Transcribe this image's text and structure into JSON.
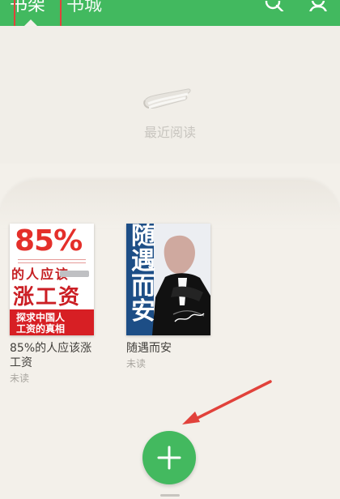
{
  "header": {
    "tabs": [
      {
        "label": "书架",
        "active": true
      },
      {
        "label": "书城",
        "active": false
      }
    ],
    "icons": [
      "search-icon",
      "user-icon"
    ]
  },
  "recent": {
    "icon": "bookmark-icon",
    "label": "最近阅读"
  },
  "books": [
    {
      "title_lines": [
        "85%的人应该涨",
        "工资"
      ],
      "status": "未读",
      "cover": {
        "headline": "85%",
        "subtitle": "的人应该",
        "main": "涨工资",
        "band_line_1": "探求中国人",
        "band_line_2": "工资的真相",
        "accent": "#d71f24"
      }
    },
    {
      "title_lines": [
        "随遇而安"
      ],
      "status": "未读",
      "cover": {
        "title": "随遇而安",
        "accent": "#1d4e86"
      }
    }
  ],
  "actions": {
    "add_icon": "plus-icon"
  },
  "colors": {
    "primary": "#42b95f",
    "annotation": "#e1423b",
    "background": "#f3f0ea"
  }
}
